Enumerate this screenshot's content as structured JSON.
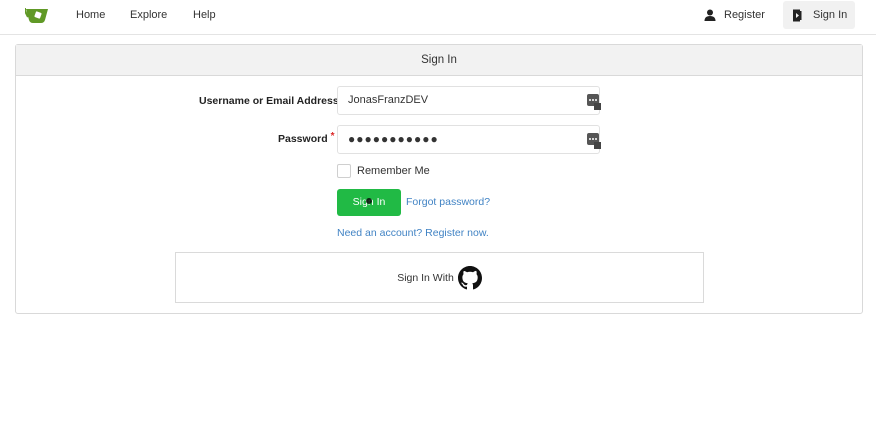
{
  "nav": {
    "home": "Home",
    "explore": "Explore",
    "help": "Help",
    "register": "Register",
    "sign_in": "Sign In"
  },
  "card": {
    "title": "Sign In",
    "username_label": "Username or Email Address",
    "username_value": "JonasFranzDEV",
    "password_label": "Password",
    "password_value": "●●●●●●●●●●●",
    "required_marker": "*",
    "remember_label": "Remember Me",
    "sign_in_button": "Sign In",
    "forgot_link": "Forgot password?",
    "register_link": "Need an account? Register now.",
    "oauth_text": "Sign In With"
  },
  "colors": {
    "brand_green": "#609926",
    "primary_button": "#21ba45",
    "link": "#4183c4",
    "required": "#db2828"
  }
}
